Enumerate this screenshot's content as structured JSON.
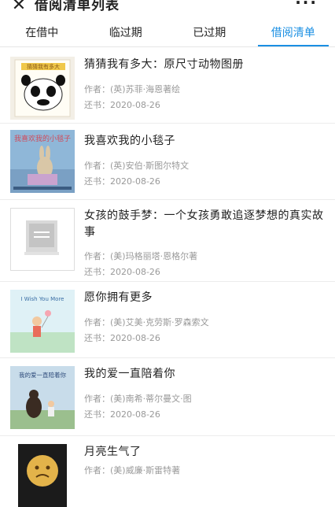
{
  "header": {
    "close_icon": "close-icon",
    "title": "借阅清单列表",
    "more_label": "···"
  },
  "tabs": [
    {
      "label": "在借中",
      "active": false
    },
    {
      "label": "临过期",
      "active": false
    },
    {
      "label": "已过期",
      "active": false
    },
    {
      "label": "借阅清单",
      "active": true
    }
  ],
  "accent_color": "#1a8fe3",
  "books": [
    {
      "title": "猜猜我有多大：原尺寸动物图册",
      "author_label": "作者：",
      "author": "(英)苏菲·海恩著绘",
      "date_label": "还书：",
      "date": "2020-08-26",
      "cover_text": "猜猜我有多大"
    },
    {
      "title": "我喜欢我的小毯子",
      "author_label": "作者：",
      "author": "(英)安伯·斯图尔特文",
      "date_label": "还书：",
      "date": "2020-08-26",
      "cover_text": "我喜欢我的小毯子"
    },
    {
      "title": "女孩的鼓手梦：一个女孩勇敢追逐梦想的真实故事",
      "author_label": "作者：",
      "author": "(美)玛格丽塔·恩格尔著",
      "date_label": "还书：",
      "date": "2020-08-26",
      "cover_text": ""
    },
    {
      "title": "愿你拥有更多",
      "author_label": "作者：",
      "author": "(美)艾美·克劳斯·罗森索文",
      "date_label": "还书：",
      "date": "2020-08-26",
      "cover_text": "I Wish You More"
    },
    {
      "title": "我的爱一直陪着你",
      "author_label": "作者：",
      "author": "(美)南希·蒂尔曼文·图",
      "date_label": "还书：",
      "date": "2020-08-26",
      "cover_text": "我的爱一直陪着你"
    },
    {
      "title": "月亮生气了",
      "author_label": "作者：",
      "author": "(美)威廉·斯雷特著",
      "date_label": "",
      "date": "",
      "cover_text": ""
    }
  ]
}
